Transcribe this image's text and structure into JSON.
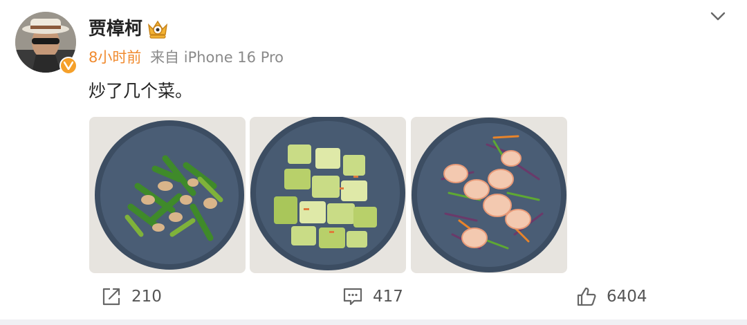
{
  "post": {
    "author": "贾樟柯",
    "time": "8小时前",
    "source": "来自 iPhone 16 Pro",
    "content": "炒了几个菜。"
  },
  "photos": [
    {
      "name": "photo-1",
      "dish": "vegetable-pork"
    },
    {
      "name": "photo-2",
      "dish": "loofah-stirfry"
    },
    {
      "name": "photo-3",
      "dish": "shrimp-salad"
    }
  ],
  "actions": {
    "repost": "210",
    "comment": "417",
    "like": "6404"
  },
  "icons": [
    "avatar",
    "verified-icon",
    "vip-icon",
    "chevron-down-icon",
    "repost-icon",
    "comment-icon",
    "like-icon"
  ],
  "colors": {
    "time": "#f08a2e",
    "verified": "#f5a02a",
    "meta": "#8a8a8a",
    "text": "#222222"
  }
}
